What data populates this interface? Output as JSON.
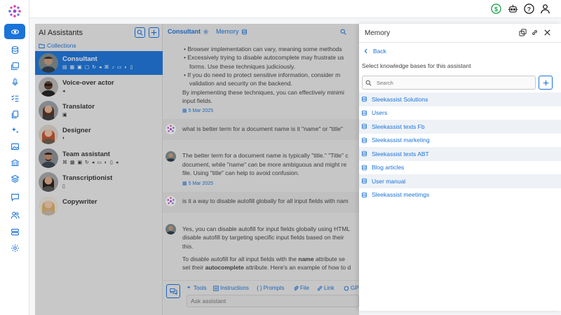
{
  "topbar": {
    "icons": [
      "dollar-icon",
      "robot-icon",
      "help-icon",
      "user-icon"
    ]
  },
  "rail": {
    "icons": [
      "assistants-icon",
      "database-icon",
      "gallery-icon",
      "microphone-icon",
      "tasks-icon",
      "documents-icon",
      "sparkles-icon",
      "image-icon",
      "institution-icon",
      "layers-icon",
      "chat-icon",
      "users-icon",
      "server-icon",
      "settings-icon"
    ]
  },
  "assistants": {
    "title": "AI Assistants",
    "collections_label": "Collections",
    "items": [
      {
        "name": "Consultant",
        "caps": "▤ ▦ ▣ ▢ ↻ ◂ ⌘ ♪ ▭ ◐ ▯"
      },
      {
        "name": "Voice-over actor",
        "caps": "◂"
      },
      {
        "name": "Translator",
        "caps": "▣"
      },
      {
        "name": "Designer",
        "caps": "◐"
      },
      {
        "name": "Team assistant",
        "caps": "⌘ ▦ ▣ ↻ ◂ ▭ ◐ ▯ ◂"
      },
      {
        "name": "Transcriptionist",
        "caps": "▯"
      },
      {
        "name": "Copywriter",
        "caps": ""
      }
    ]
  },
  "chat": {
    "tabs": {
      "consultant": "Consultant",
      "memory": "Memory"
    },
    "lines_top": [
      "• Browser implementation can vary, meaning some methods",
      "• Excessively trying to disable autocomplete may frustrate us",
      "  forms. Use these techniques judiciously.",
      "• If you do need to protect sensitive information, consider m",
      "  validation and security on the backend.",
      "By implementing these techniques, you can effectively minimi",
      "input fields."
    ],
    "date1": "5 Mar 2025",
    "question1": "what is better term for a document name is it \"name\" or \"title\"",
    "answer1": [
      "The better term for a document name is typically \"title.\" \"Title\" c",
      "document, while \"name\" can be more ambiguous and might re",
      "file. Using \"title\" can help to avoid confusion."
    ],
    "date2": "5 Mar 2025",
    "question2": "is it a way to disable autofill globally for all input fields with nam",
    "answer2": [
      "Yes, you can disable autofill for input fields globally using HTML",
      "disable autofill by targeting specific input fields based on their",
      "this."
    ],
    "answer2b_pre": "To disable autofill for all input fields with the ",
    "answer2b_bold1": "name",
    "answer2b_mid": " attribute se",
    "answer2b_line2_pre": "set their ",
    "answer2b_bold2": "autocomplete",
    "answer2b_line2_post": " attribute. Here's an example of how to d",
    "toolbar": [
      "Tools",
      "Instructions",
      "Prompts",
      "File",
      "Link",
      "GP"
    ],
    "input_placeholder": "Ask assistant"
  },
  "memory": {
    "title": "Memory",
    "back_label": "Back",
    "subtitle": "Select knowledge bases for this assistant",
    "search_placeholder": "Search",
    "knowledge_bases": [
      "Sleekassist Solutions",
      "Users",
      "Sleekassist texts Fb",
      "Sleekassist marketing",
      "Sleekassist texts ABT",
      "Blog articles",
      "User manual",
      "Sleekassist meetimgs"
    ]
  },
  "colors": {
    "accent": "#1a73d9",
    "green": "#1aa34a"
  }
}
